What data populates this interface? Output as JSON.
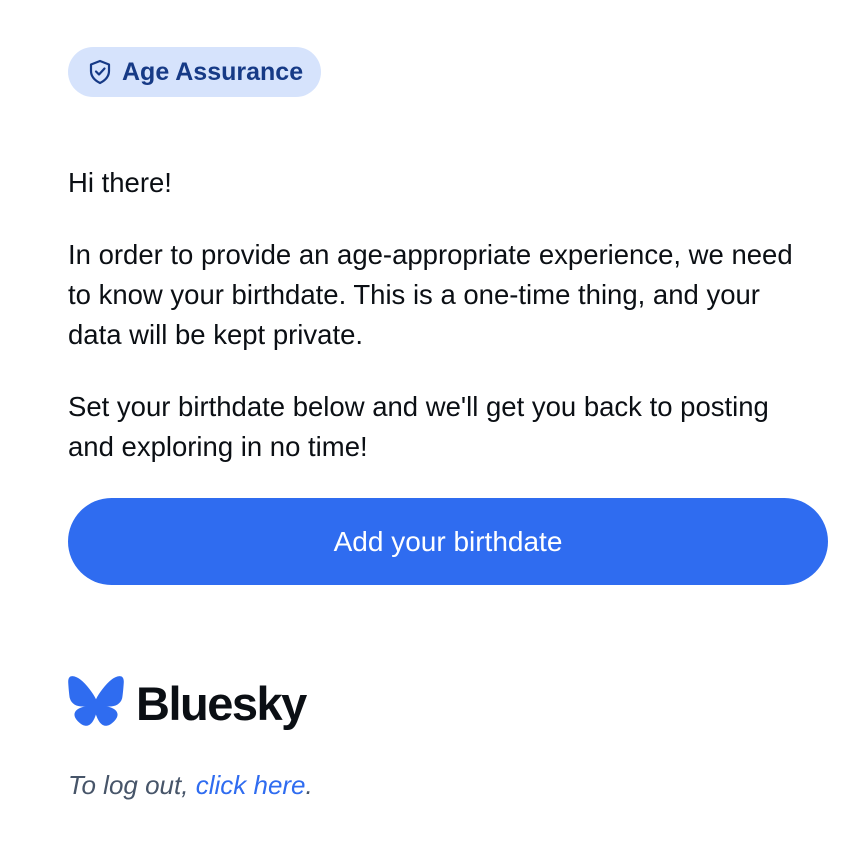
{
  "badge": {
    "icon": "shield-check-icon",
    "label": "Age Assurance"
  },
  "content": {
    "greeting": "Hi there!",
    "body_1": "In order to provide an age-appropriate experience, we need to know your birthdate. This is a one-time thing, and your data will be kept private.",
    "body_2": "Set your birthdate below and we'll get you back to posting and exploring in no time!"
  },
  "cta": {
    "label": "Add your birthdate"
  },
  "brand": {
    "icon": "butterfly-icon",
    "name": "Bluesky"
  },
  "footer": {
    "prefix": "To log out, ",
    "link_label": "click here",
    "suffix": "."
  },
  "colors": {
    "accent": "#2f6cf0",
    "badge_bg": "#d6e3fc",
    "badge_text": "#163a86",
    "text": "#0b0f14",
    "muted": "#475569"
  }
}
